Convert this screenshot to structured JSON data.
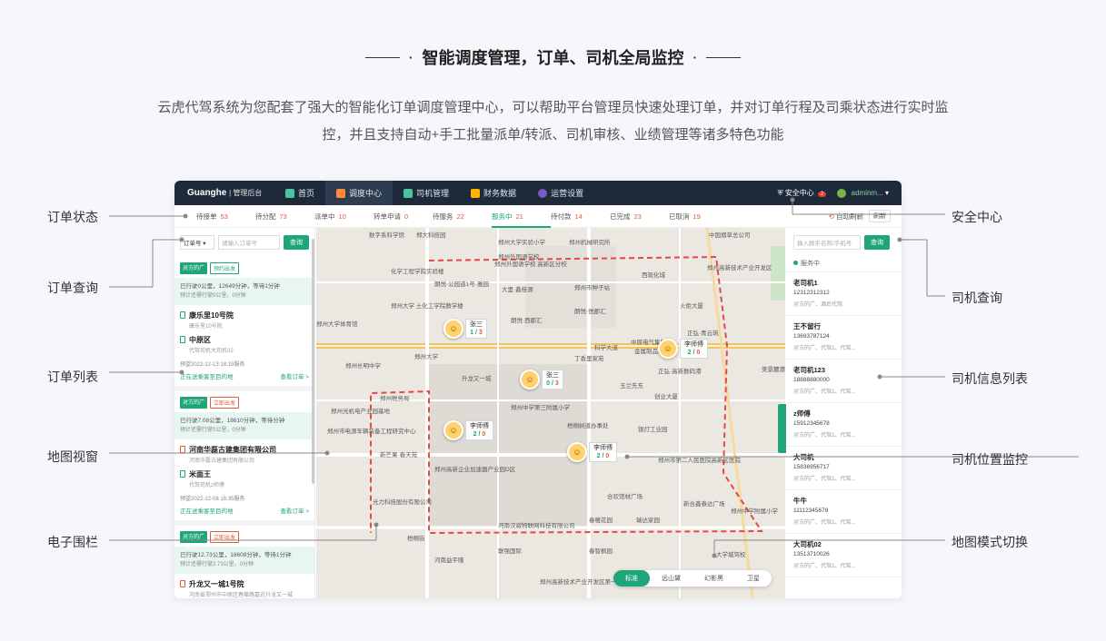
{
  "heading": {
    "title": "智能调度管理，订单、司机全局监控",
    "description": "云虎代驾系统为您配套了强大的智能化订单调度管理中心，可以帮助平台管理员快速处理订单，并对订单行程及司乘状态进行实时监控，并且支持自动+手工批量派单/转派、司机审核、业绩管理等诸多特色功能"
  },
  "app": {
    "brand": "Guanghe",
    "brand_sub": "| 管理后台",
    "nav": [
      {
        "label": "首页",
        "icon": "home-icon"
      },
      {
        "label": "调度中心",
        "icon": "dispatch-icon"
      },
      {
        "label": "司机管理",
        "icon": "driver-icon"
      },
      {
        "label": "财务数据",
        "icon": "finance-icon"
      },
      {
        "label": "运营设置",
        "icon": "settings-icon"
      }
    ],
    "security_label": "安全中心",
    "security_badge": "2",
    "user": "adminm...",
    "status_tabs": [
      {
        "label": "待接单",
        "count": "53"
      },
      {
        "label": "待分配",
        "count": "73"
      },
      {
        "label": "派单中",
        "count": "10"
      },
      {
        "label": "转单申请",
        "count": "0"
      },
      {
        "label": "待服务",
        "count": "22"
      },
      {
        "label": "服务中",
        "count": "21"
      },
      {
        "label": "待付款",
        "count": "14"
      },
      {
        "label": "已完成",
        "count": "23"
      },
      {
        "label": "已取消",
        "count": "19"
      }
    ],
    "auto_refresh": "自动刷新",
    "refresh": "刷新",
    "order_search": {
      "select": "订单号",
      "placeholder": "请输入订单号",
      "button": "查询"
    },
    "orders": [
      {
        "tags": [
          "对方的广",
          "预约出发"
        ],
        "trip": "已行驶0公里，12649分钟，等待1分钟",
        "trip_sub": "预计还需行驶0公里，0分钟",
        "from": "康乐里10号院",
        "from_sub": "康乐里10号院",
        "to": "中原区",
        "to_sub": "代驾司机大司机02",
        "time": "预望2022-12-13 18:19服务",
        "status": "正在送乘客至目的地",
        "link": "查看订单 >"
      },
      {
        "tags": [
          "对方的广",
          "立即出发"
        ],
        "trip": "已行驶7.08公里，18610分钟，等待分钟",
        "trip_sub": "预计还需行驶0公里，0分钟",
        "from": "河南华磊古建集团有限公司",
        "from_sub": "河南华磊古建集团有限公司",
        "to": "米面王",
        "to_sub": "代驾司机z师傅",
        "time": "预望2022-12-08 16:35服务",
        "status": "正在送乘客至目的地",
        "link": "查看订单 >"
      },
      {
        "tags": [
          "对方的广",
          "立即出发"
        ],
        "trip": "已行驶12.73公里，18608分钟，等待1分钟",
        "trip_sub": "预计还需行驶2.73公里，0分钟",
        "from": "升龙又一城1号院",
        "from_sub": "河南省郑州市中原区春藤路嘉近升龙又一城"
      }
    ],
    "map_labels": [
      "数字系科学馆",
      "郑大科技园",
      "郑州大学实验小学",
      "郑州机械研究所",
      "中国烟草总公司",
      "郑州外国语学校",
      "郑州外国语学校 高新区分校",
      "郑州高新技术产业开发区",
      "化学工程学院实验楼",
      "朗悦·公园道1号·雅园",
      "大里·鑫桂源",
      "郑州市种子站",
      "西现化城",
      "郑州大学 土化工学院教学楼",
      "火炬大厦",
      "郑州大学体育馆",
      "朗悦·西郡汇",
      "朗悦·悦郡汇",
      "正弘·青云筑",
      "科学大道",
      "郑州大学",
      "中原电气集团",
      "金属制品研",
      "郑州长明中学",
      "升龙又一城",
      "丁香里家苑",
      "正弘·高新数码港",
      "美景麓港",
      "郑州中学第三附属小学",
      "玉兰先东",
      "创业大厦",
      "郑州光机电产业园基地",
      "郑州市电源车辆装备工程研究中心",
      "郑州税务局",
      "梧桐树道办事处",
      "银灯工业园",
      "新芒果·春天苑",
      "郑州高新企业加速器产业园D区",
      "郑州市第二人民医院高新区医院",
      "光力科技股份有限公司",
      "合欢馆材广场",
      "新合鑫春达广场",
      "春暖花园",
      "瑞达家园",
      "郑州中学附属小学",
      "河南汉威物联网科技有限公司",
      "梧桐街",
      "河南益平隆",
      "联强国际",
      "春智枫园",
      "大学城驾校",
      "郑州高新技术产业开发区第一中学"
    ],
    "drivers_on_map": [
      {
        "name": "张三",
        "load": "1",
        "cap": "3"
      },
      {
        "name": "李师傅",
        "load": "2",
        "cap": "0"
      },
      {
        "name": "张三",
        "load": "0",
        "cap": "3"
      },
      {
        "name": "李师傅",
        "load": "2",
        "cap": "0"
      },
      {
        "name": "李师傅",
        "load": "2",
        "cap": "0"
      }
    ],
    "map_modes": [
      "标准",
      "远山黛",
      "幻影黑",
      "卫星"
    ],
    "driver_search": {
      "placeholder": "输入顾手名称/手机号",
      "button": "查询"
    },
    "driver_status": "服务中",
    "drivers": [
      {
        "name": "老司机1",
        "phone": "12312312312",
        "tags": "对方的广、酒后代驾"
      },
      {
        "name": "王不留行",
        "phone": "13693787124",
        "tags": "对方的广、代驾1、代驾..."
      },
      {
        "name": "老司机123",
        "phone": "18888880000",
        "tags": "对方的广、代驾1、代驾..."
      },
      {
        "name": "z师傅",
        "phone": "15912345678",
        "tags": "对方的广、代驾1、代驾..."
      },
      {
        "name": "大司机",
        "phone": "15836956717",
        "tags": "对方的广、代驾1、代驾..."
      },
      {
        "name": "牛牛",
        "phone": "11112345678",
        "tags": "对方的广、代驾1、代驾..."
      },
      {
        "name": "大司机02",
        "phone": "13513710026",
        "tags": "对方的广、代驾1、代驾..."
      }
    ]
  },
  "callouts": {
    "order_status": "订单状态",
    "order_query": "订单查询",
    "order_list": "订单列表",
    "map_view": "地图视窗",
    "geofence": "电子围栏",
    "security_center": "安全中心",
    "driver_query": "司机查询",
    "driver_list": "司机信息列表",
    "driver_location": "司机位置监控",
    "map_mode": "地图模式切换"
  },
  "colors": {
    "accent": "#1ea57a",
    "danger": "#e25b3a",
    "nav_bg": "#1e2a3a"
  }
}
